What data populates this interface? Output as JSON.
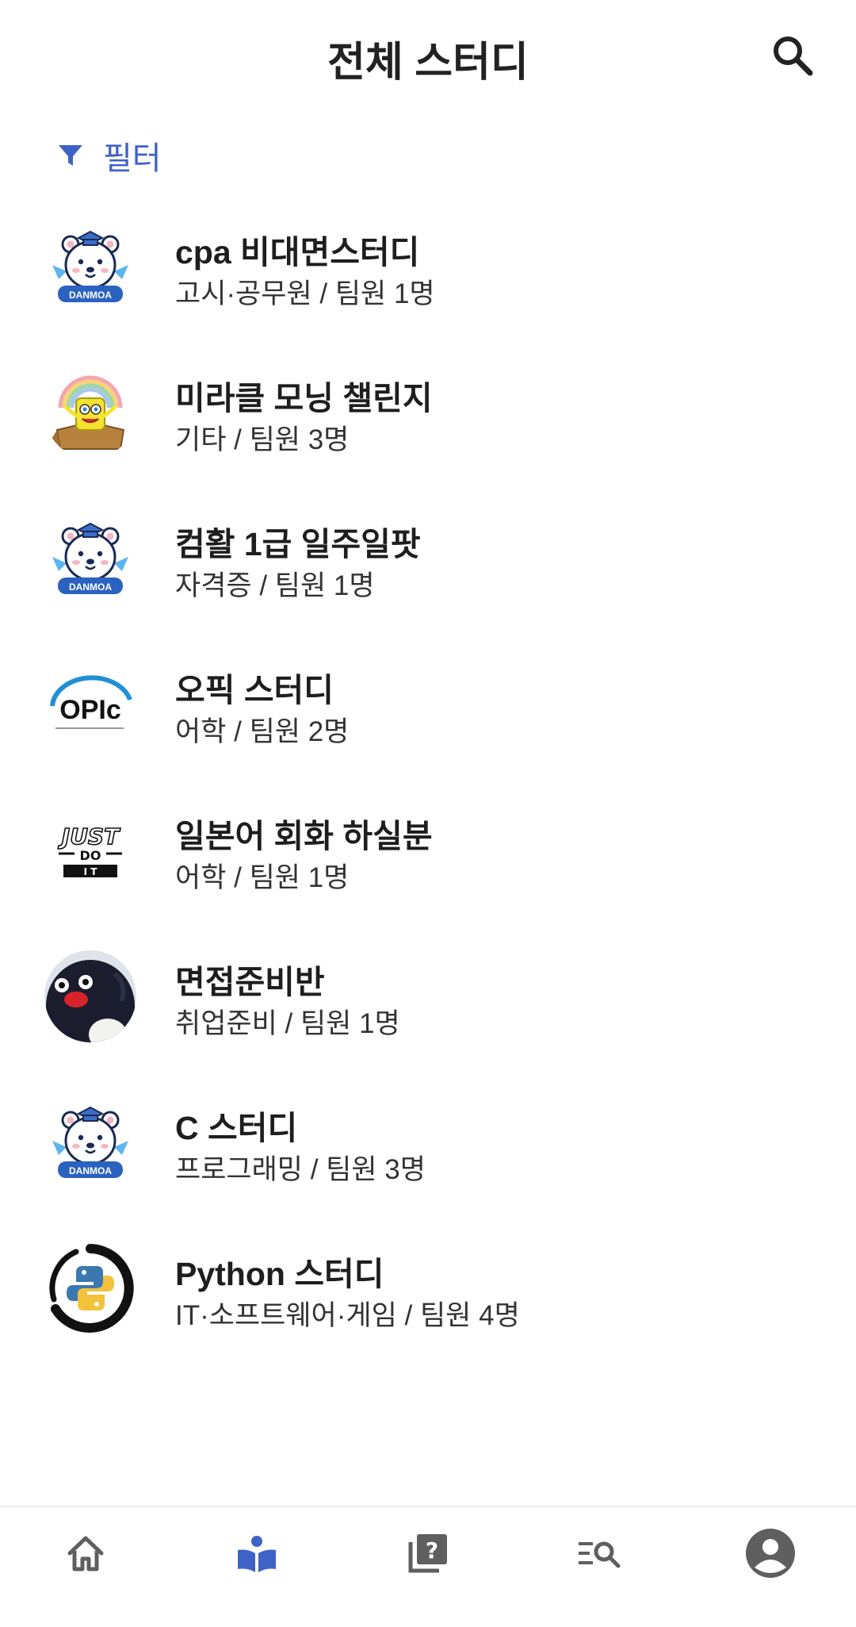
{
  "header": {
    "title": "전체 스터디",
    "search_icon": "search-icon"
  },
  "filter": {
    "label": "필터",
    "icon": "filter-icon",
    "color": "#3f62c7"
  },
  "studies": [
    {
      "title": "cpa 비대면스터디",
      "meta": "고시·공무원 / 팀원 1명",
      "avatar": "danmoa-bear"
    },
    {
      "title": "미라클 모닝 챌린지",
      "meta": "기타 / 팀원 3명",
      "avatar": "spongebob-rainbow"
    },
    {
      "title": "컴활 1급 일주일팟",
      "meta": "자격증 / 팀원 1명",
      "avatar": "danmoa-bear"
    },
    {
      "title": "오픽 스터디",
      "meta": "어학 / 팀원 2명",
      "avatar": "opic-logo"
    },
    {
      "title": "일본어 회화 하실분",
      "meta": "어학 / 팀원 1명",
      "avatar": "just-do-it"
    },
    {
      "title": "면접준비반",
      "meta": "취업준비 / 팀원 1명",
      "avatar": "pingu"
    },
    {
      "title": "C 스터디",
      "meta": "프로그래밍 / 팀원 3명",
      "avatar": "danmoa-bear"
    },
    {
      "title": "Python 스터디",
      "meta": "IT·소프트웨어·게임 / 팀원 4명",
      "avatar": "python-logo"
    }
  ],
  "avatar_text": {
    "danmoa": "DANMOA",
    "opic": "OPIc",
    "just": "JUST",
    "do": "DO",
    "it": "I T"
  },
  "bottom_nav": [
    {
      "name": "home",
      "icon": "home-icon",
      "active": false
    },
    {
      "name": "study",
      "icon": "open-book-icon",
      "active": true
    },
    {
      "name": "qna",
      "icon": "question-library-icon",
      "active": false
    },
    {
      "name": "search-list",
      "icon": "manage-search-icon",
      "active": false
    },
    {
      "name": "profile",
      "icon": "account-circle-icon",
      "active": false
    }
  ],
  "colors": {
    "accent": "#3f62c7",
    "nav_inactive": "#5f5f5f",
    "text_primary": "#1e1e1e"
  }
}
